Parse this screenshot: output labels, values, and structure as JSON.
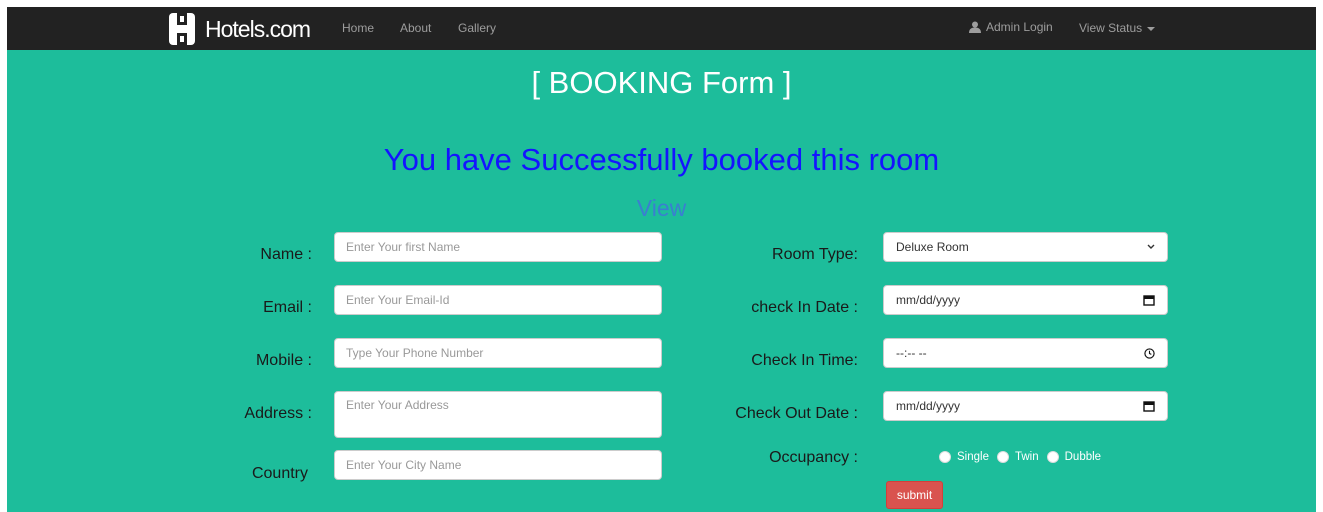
{
  "navbar": {
    "brand": "Hotels.com",
    "links": [
      "Home",
      "About",
      "Gallery"
    ],
    "admin_login": "Admin Login",
    "view_status": "View Status"
  },
  "main": {
    "title": "[ BOOKING Form ]",
    "success_message": "You have Successfully booked this room",
    "view_link": "View"
  },
  "left_form": {
    "name_label": "Name :",
    "name_placeholder": "Enter Your first Name",
    "email_label": "Email :",
    "email_placeholder": "Enter Your Email-Id",
    "mobile_label": "Mobile :",
    "mobile_placeholder": "Type Your Phone Number",
    "address_label": "Address :",
    "address_placeholder": "Enter Your Address",
    "country_label": "Country",
    "country_placeholder": "Enter Your City Name"
  },
  "right_form": {
    "room_type_label": "Room Type:",
    "room_type_value": "Deluxe Room",
    "checkin_date_label": "check In Date :",
    "checkin_date_value": "mm/dd/yyyy",
    "checkin_time_label": "Check In Time:",
    "checkin_time_value": "--:-- --",
    "checkout_date_label": "Check Out Date :",
    "checkout_date_value": "mm/dd/yyyy",
    "occupancy_label": "Occupancy :",
    "occupancy_options": [
      "Single",
      "Twin",
      "Dubble"
    ],
    "submit_label": "submit"
  },
  "colors": {
    "background": "#1dbd9b",
    "navbar": "#222222",
    "success_text": "#1414ff",
    "view_link": "#3a7fd0",
    "submit_button": "#d9534f"
  },
  "icons": {
    "brand": "hotels-logo-icon",
    "admin": "user-icon",
    "calendar": "calendar-icon",
    "clock": "clock-icon",
    "select": "chevron-down-icon"
  }
}
